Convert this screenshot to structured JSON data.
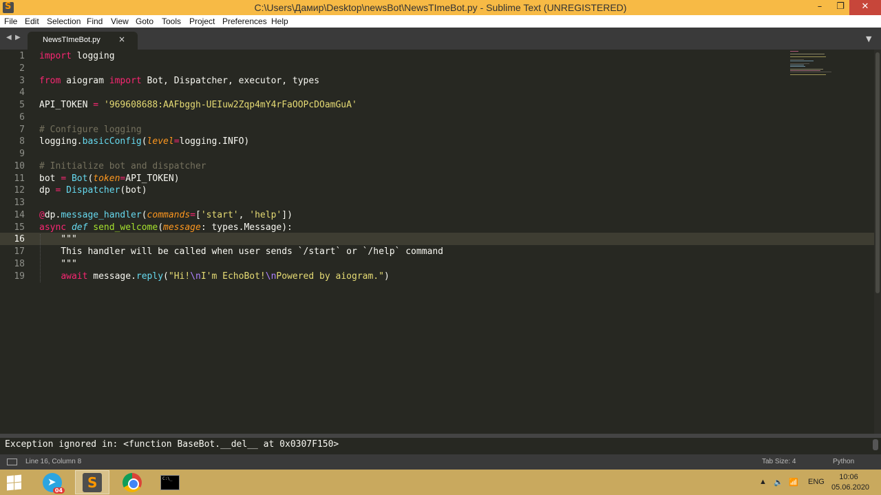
{
  "window": {
    "title": "C:\\Users\\Дамир\\Desktop\\newsBot\\NewsTImeBot.py - Sublime Text (UNREGISTERED)",
    "min_glyph": "–",
    "max_glyph": "❐",
    "close_glyph": "✕"
  },
  "menu": [
    "File",
    "Edit",
    "Selection",
    "Find",
    "View",
    "Goto",
    "Tools",
    "Project",
    "Preferences",
    "Help"
  ],
  "tabs": [
    {
      "label": "NewsTImeBot.py",
      "close": "×"
    }
  ],
  "editor": {
    "line_numbers": [
      "1",
      "2",
      "3",
      "4",
      "5",
      "6",
      "7",
      "8",
      "9",
      "10",
      "11",
      "12",
      "13",
      "14",
      "15",
      "16",
      "17",
      "18",
      "19"
    ],
    "active_line": "16",
    "code": {
      "l1_kw": "import",
      "l1_rest": " logging",
      "l3_from": "from",
      "l3_mod": " aiogram ",
      "l3_import": "import",
      "l3_rest": " Bot, Dispatcher, executor, types",
      "l5_name": "API_TOKEN ",
      "l5_eq": "=",
      "l5_sp": " ",
      "l5_str": "'969608688:AAFbggh-UEIuw2Zqp4mY4rFaOOPcDOamGuA'",
      "l7": "# Configure logging",
      "l8_a": "logging.",
      "l8_fn": "basicConfig",
      "l8_b": "(",
      "l8_arg": "level",
      "l8_eq": "=",
      "l8_c": "logging.INFO)",
      "l10": "# Initialize bot and dispatcher",
      "l11_a": "bot ",
      "l11_eq": "=",
      "l11_sp": " ",
      "l11_fn": "Bot",
      "l11_b": "(",
      "l11_arg": "token",
      "l11_eq2": "=",
      "l11_c": "API_TOKEN)",
      "l12_a": "dp ",
      "l12_eq": "=",
      "l12_sp": " ",
      "l12_fn": "Dispatcher",
      "l12_c": "(bot)",
      "l14_at": "@",
      "l14_a": "dp.",
      "l14_fn": "message_handler",
      "l14_b": "(",
      "l14_arg": "commands",
      "l14_eq": "=",
      "l14_c": "[",
      "l14_s1": "'start'",
      "l14_d": ", ",
      "l14_s2": "'help'",
      "l14_e": "])",
      "l15_async": "async",
      "l15_sp": " ",
      "l15_def": "def",
      "l15_sp2": " ",
      "l15_fn": "send_welcome",
      "l15_b": "(",
      "l15_arg": "message",
      "l15_c": ": types.Message):",
      "l16": "    \"\"\"",
      "l17": "    This handler will be called when user sends `/start` or `/help` command",
      "l18": "    \"\"\"",
      "l19_ind": "    ",
      "l19_await": "await",
      "l19_a": " message.",
      "l19_fn": "reply",
      "l19_b": "(",
      "l19_s1": "\"Hi!",
      "l19_e1": "\\n",
      "l19_s2": "I'm EchoBot!",
      "l19_e2": "\\n",
      "l19_s3": "Powered by aiogram.\"",
      "l19_c": ")"
    }
  },
  "console": {
    "text": "Exception ignored in: <function BaseBot.__del__ at 0x0307F150>"
  },
  "status": {
    "position": "Line 16, Column 8",
    "tab_size": "Tab Size: 4",
    "syntax": "Python"
  },
  "taskbar": {
    "telegram_badge": "04",
    "language": "ENG",
    "time": "10:06",
    "date": "05.06.2020",
    "tray_arrow": "▲",
    "volume_glyph": "🔈",
    "network_glyph": "📶"
  },
  "colors": {
    "titlebar": "#f7ba45",
    "editor_bg": "#272822",
    "keyword": "#f92672",
    "string": "#e6db74",
    "comment": "#75715e",
    "function": "#66d9ef",
    "argument": "#fd971f"
  }
}
